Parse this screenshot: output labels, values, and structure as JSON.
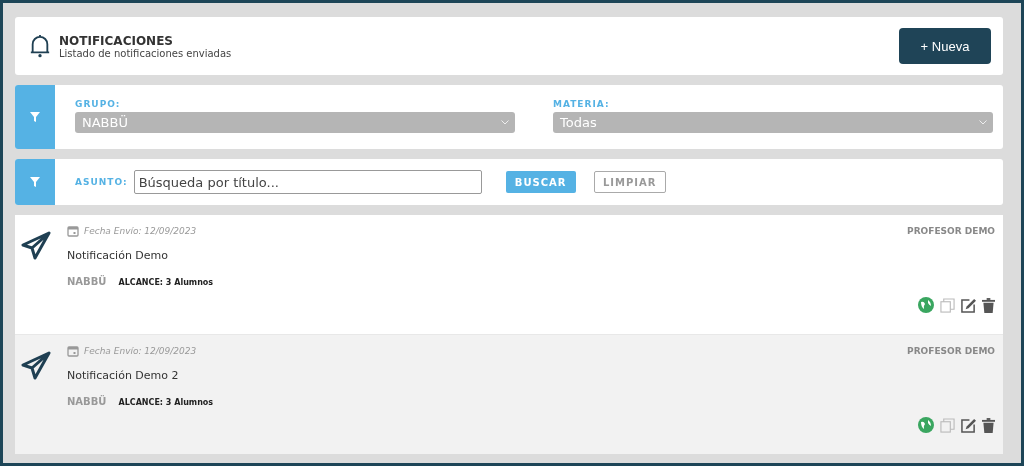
{
  "header": {
    "title": "NOTIFICACIONES",
    "subtitle": "Listado de notificaciones enviadas",
    "new_button": "+ Nueva"
  },
  "filters": {
    "group": {
      "label": "GRUPO:",
      "value": "NABBÜ"
    },
    "subject": {
      "label": "MATERIA:",
      "value": "Todas"
    }
  },
  "search": {
    "label": "ASUNTO:",
    "placeholder": "Búsqueda por título...",
    "search_button": "BUSCAR",
    "clear_button": "LIMPIAR"
  },
  "notifications": [
    {
      "date": "Fecha Envío: 12/09/2023",
      "author": "PROFESOR DEMO",
      "title": "Notificación Demo",
      "group": "NABBÜ",
      "scope": "ALCANCE: 3 Alumnos"
    },
    {
      "date": "Fecha Envío: 12/09/2023",
      "author": "PROFESOR DEMO",
      "title": "Notificación Demo 2",
      "group": "NABBÜ",
      "scope": "ALCANCE: 3 Alumnos"
    }
  ]
}
